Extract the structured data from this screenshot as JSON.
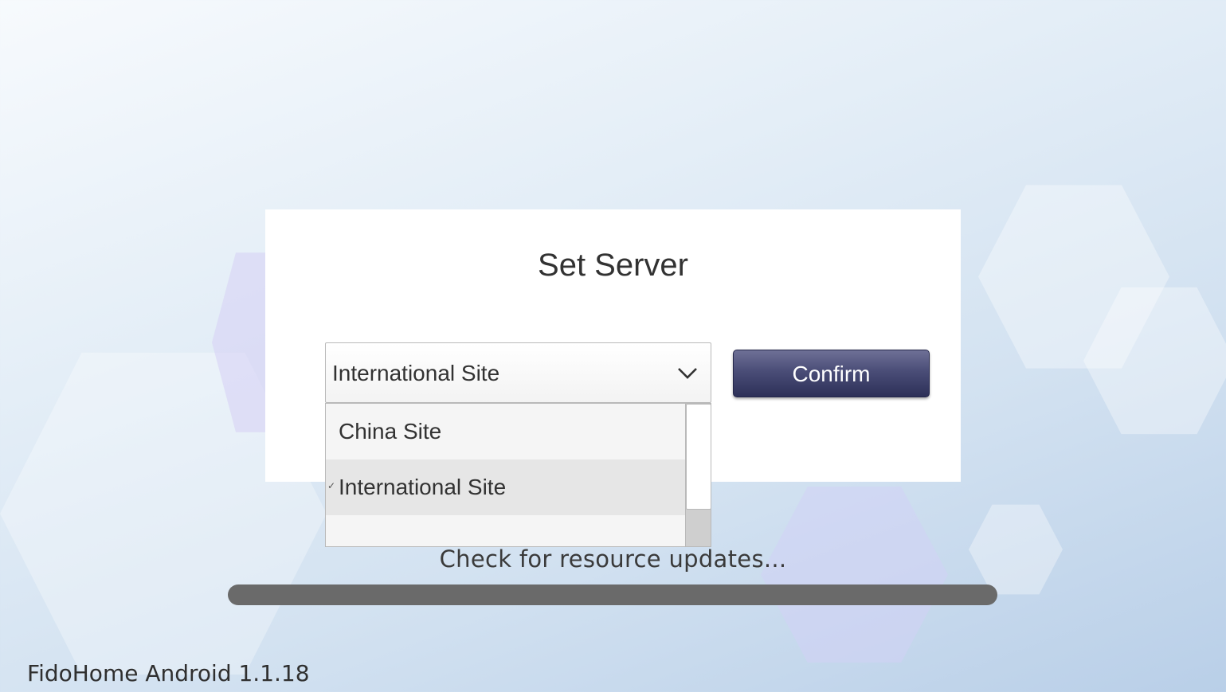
{
  "dialog": {
    "title": "Set Server"
  },
  "server_select": {
    "selected": "International Site",
    "options": [
      "China Site",
      "International Site"
    ],
    "checked_index": 1
  },
  "confirm_label": "Confirm",
  "status": {
    "message": "Check for resource updates...",
    "progress": 0
  },
  "version_label": "FidoHome Android 1.1.18",
  "colors": {
    "confirm_button": "#4a4d77",
    "progress_track": "#6a6a6a"
  }
}
